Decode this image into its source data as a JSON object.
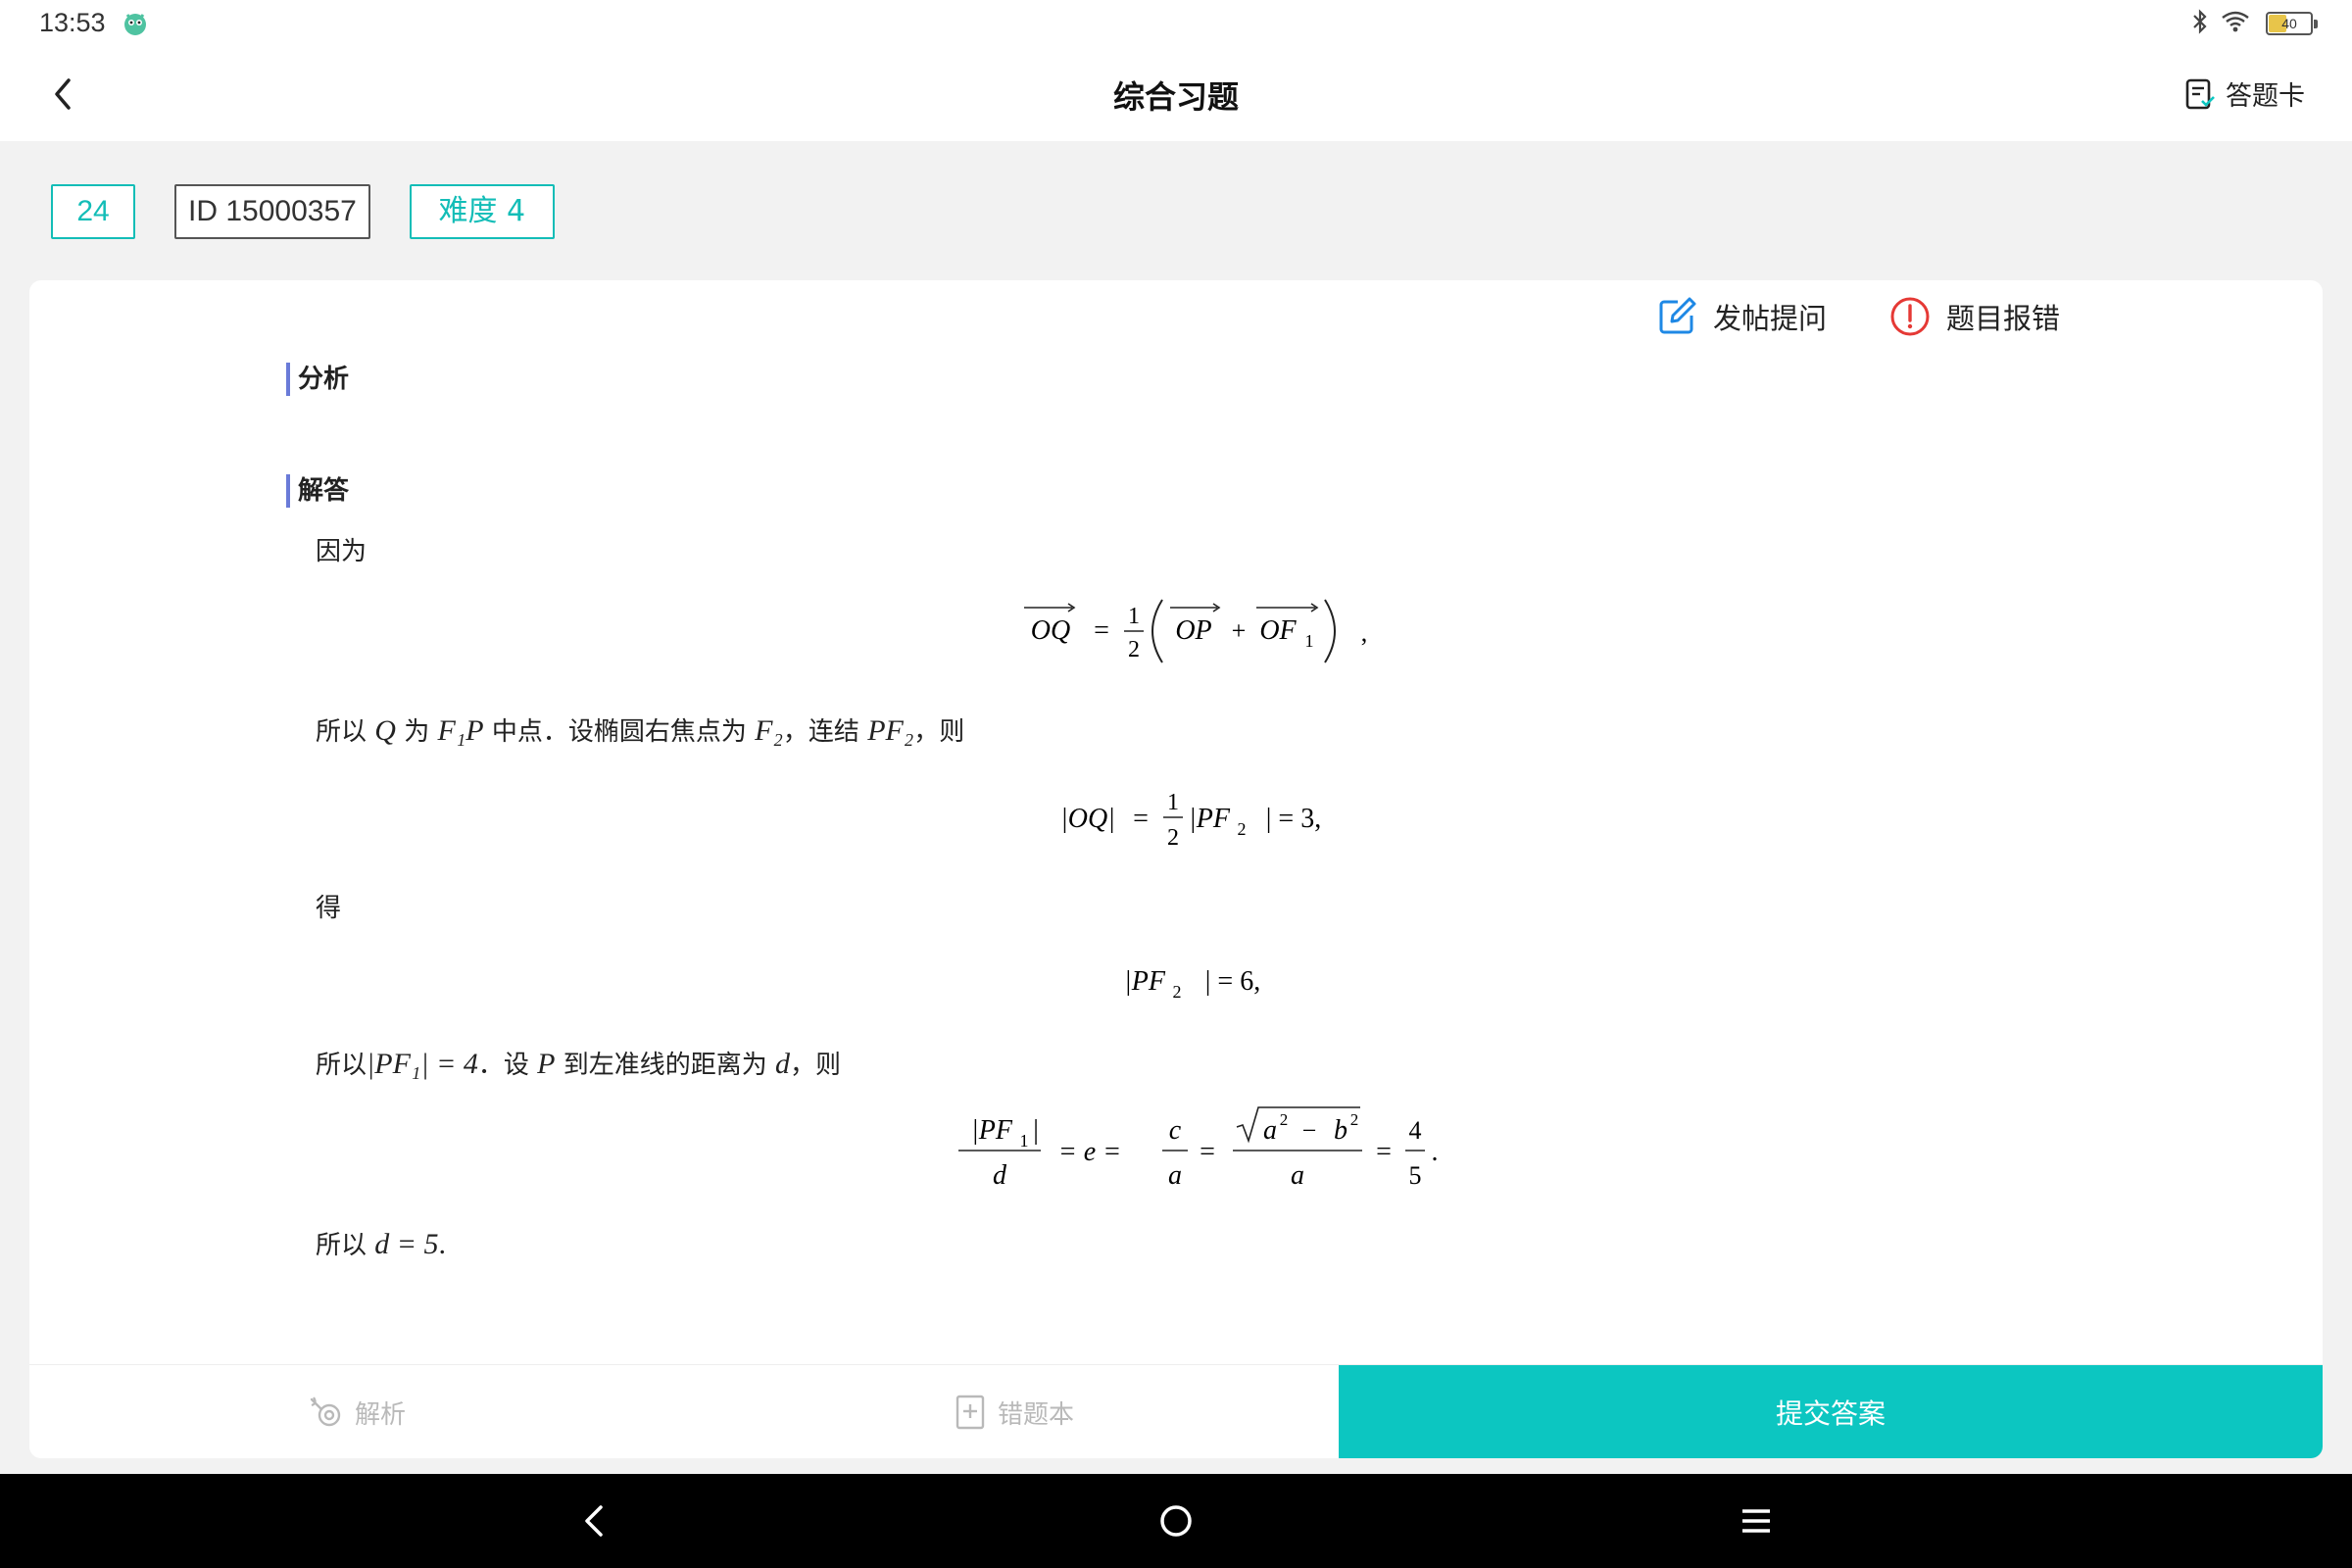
{
  "status_bar": {
    "time": "13:53",
    "battery_level": "40",
    "battery_fraction": 0.4
  },
  "header": {
    "title": "综合习题",
    "answer_card_label": "答题卡"
  },
  "tags": {
    "number": "24",
    "id": "ID 15000357",
    "difficulty": "难度 4"
  },
  "card_actions": {
    "post_question": "发帖提问",
    "report_error": "题目报错"
  },
  "sections": {
    "analysis": "分析",
    "solution": "解答"
  },
  "solution": {
    "intro": "因为",
    "line1_prefix": "所以",
    "line1_Q": "Q",
    "line1_text1": "为",
    "line1_F1P": "F₁P",
    "line1_text2": "中点．设椭圆右焦点为",
    "line1_F2": "F₂",
    "line1_text3": "，连结",
    "line1_PF2": "PF₂",
    "line1_text4": "，则",
    "de": "得",
    "line3_prefix": "所以",
    "line3_math": "|PF₁| = 4",
    "line3_text1": "．设",
    "line3_P": "P",
    "line3_text2": "到左准线的距离为",
    "line3_d": "d",
    "line3_text3": "，则",
    "line4_prefix": "所以",
    "line4_math": "d = 5",
    "line4_suffix": "."
  },
  "formulas": {
    "f1": {
      "lhs": "OQ",
      "eq": "=",
      "num": "1",
      "den": "2",
      "op": "OP",
      "plus": "+",
      "of": "OF",
      "sub": "1",
      "tail": ","
    },
    "f2": {
      "lhs": "|OQ|",
      "eq": "=",
      "num": "1",
      "den": "2",
      "mid": "|PF",
      "sub": "2",
      "rest": "| = 3,",
      "rest_eq": "=",
      "rest_val": "3,"
    },
    "f3": {
      "left": "|PF",
      "sub": "2",
      "right": "| = 6,"
    },
    "f4": {
      "num1": "|PF",
      "sub1": "1",
      "num1end": "|",
      "den1": "d",
      "eq_e": "= e =",
      "c": "c",
      "a": "a",
      "eq": "=",
      "sqrt_a": "a",
      "sq": "2",
      "minus": "−",
      "sqrt_b": "b",
      "den2": "a",
      "eq2": "=",
      "four": "4",
      "five": "5",
      "end": "."
    }
  },
  "bottom_bar": {
    "analysis_label": "解析",
    "wrongbook_label": "错题本",
    "submit_label": "提交答案"
  },
  "colors": {
    "accent": "#0cc6c1",
    "tag_teal": "#13bdb7",
    "section_bar": "#6a7bd8",
    "error_red": "#e53935",
    "post_blue": "#1e88e5"
  },
  "icons": [
    "back-arrow-icon",
    "answer-card-icon",
    "edit-icon",
    "exclamation-circle-icon",
    "analysis-icon",
    "wrongbook-icon",
    "nav-back-icon",
    "nav-home-icon",
    "nav-menu-icon",
    "bluetooth-icon",
    "wifi-icon",
    "battery-icon",
    "app-mascot-icon"
  ]
}
